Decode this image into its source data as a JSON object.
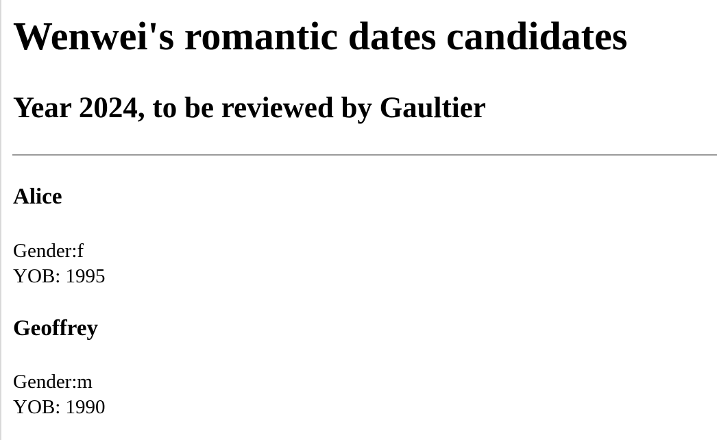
{
  "document": {
    "title": "Wenwei's romantic dates candidates",
    "subtitle": "Year 2024, to be reviewed by Gaultier"
  },
  "candidates": [
    {
      "name": "Alice",
      "gender_line": "Gender:f",
      "yob_line": "YOB: 1995"
    },
    {
      "name": "Geoffrey",
      "gender_line": "Gender:m",
      "yob_line": "YOB: 1990"
    }
  ]
}
